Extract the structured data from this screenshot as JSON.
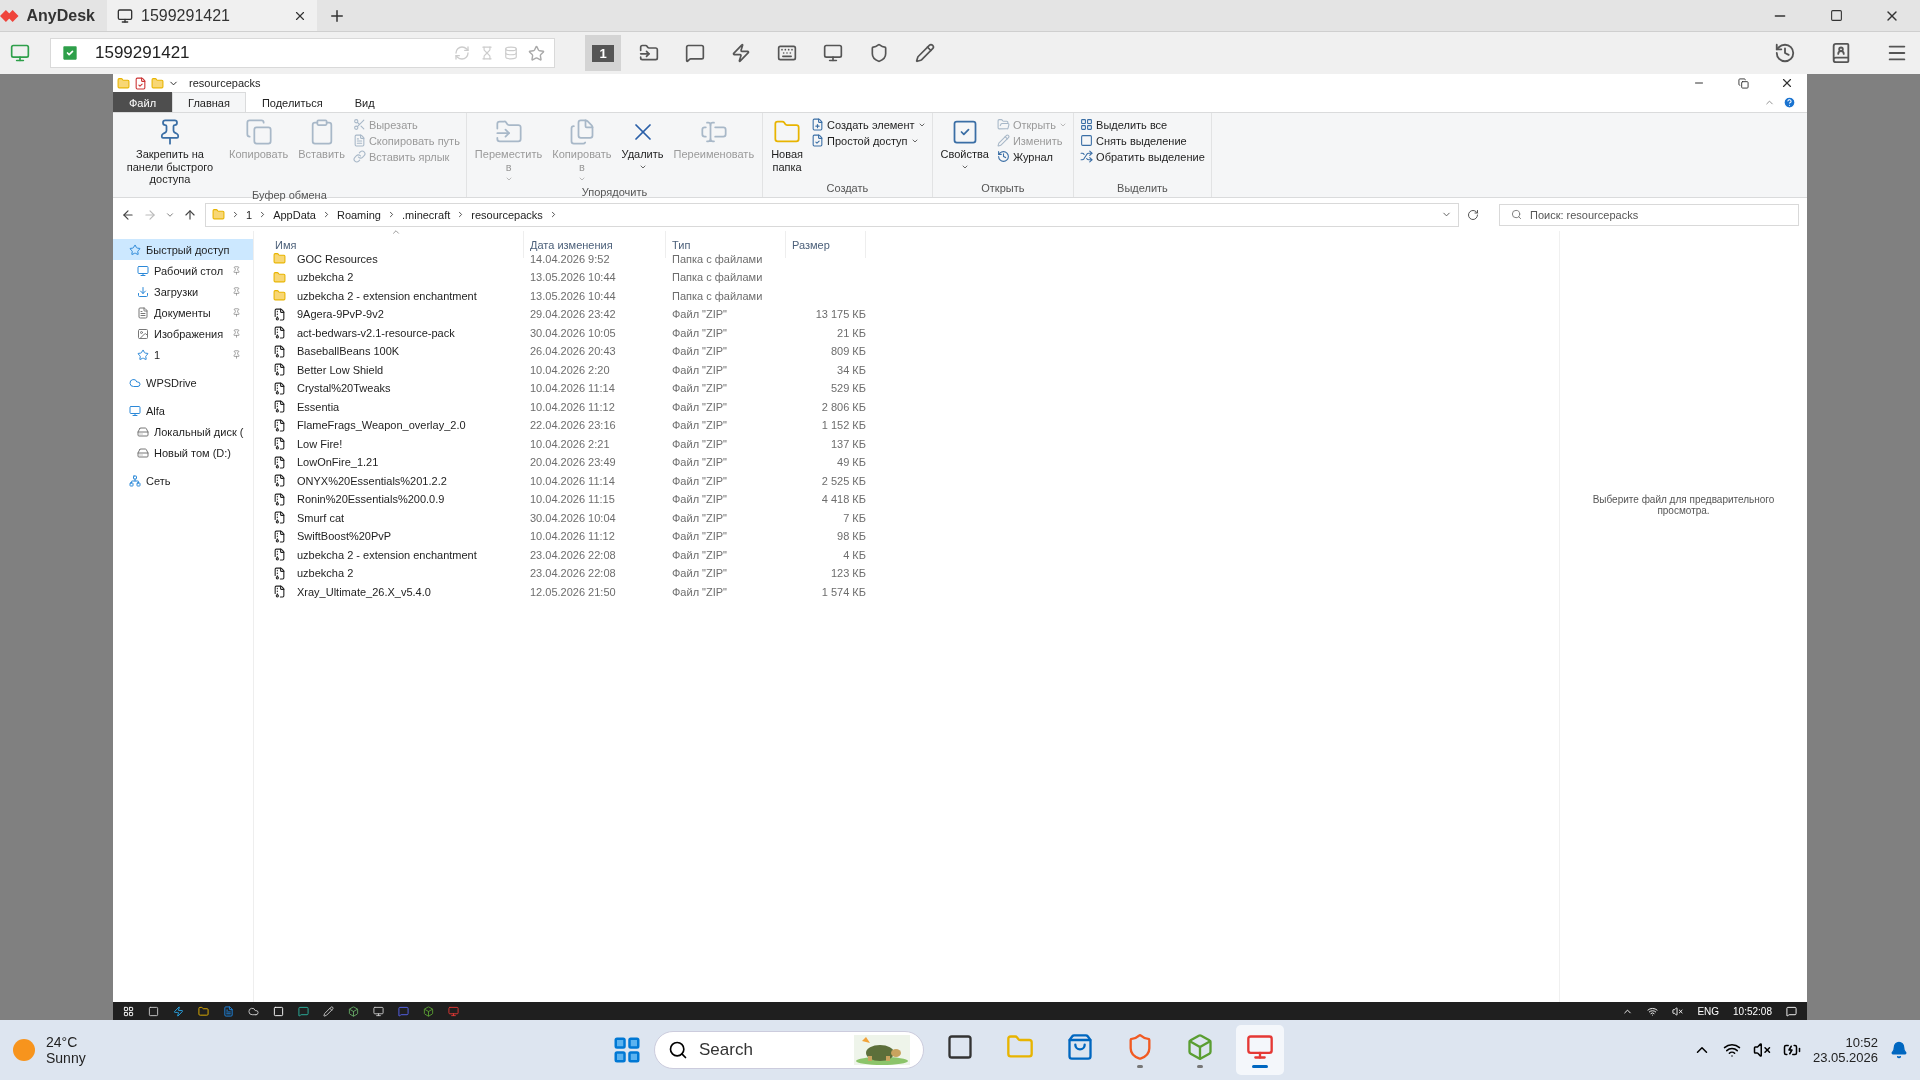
{
  "anydesk": {
    "brand": "AnyDesk",
    "tabs": [
      {
        "label": "1599291421",
        "selected": true
      }
    ],
    "address": {
      "value": "1599291421"
    },
    "monitor_button": {
      "label": "1",
      "selected": true
    }
  },
  "explorer": {
    "title": "resourcepacks",
    "tabs": [
      {
        "label": "Файл",
        "kind": "file",
        "selected": false
      },
      {
        "label": "Главная",
        "kind": "tab",
        "selected": true
      },
      {
        "label": "Поделиться",
        "kind": "tab",
        "selected": false
      },
      {
        "label": "Вид",
        "kind": "tab",
        "selected": false
      }
    ],
    "ribbon": [
      {
        "label": "Буфер обмена",
        "items": [
          {
            "label": "Закрепить на панели быстрого доступа",
            "kind": "large",
            "disabled": false,
            "menu": false
          },
          {
            "label": "Копировать",
            "kind": "large",
            "disabled": true,
            "menu": false
          },
          {
            "label": "Вставить",
            "kind": "large",
            "disabled": true,
            "menu": false
          },
          {
            "label": "Вырезать",
            "kind": "small",
            "disabled": true,
            "menu": false
          },
          {
            "label": "Скопировать путь",
            "kind": "small",
            "disabled": true,
            "menu": false
          },
          {
            "label": "Вставить ярлык",
            "kind": "small",
            "disabled": true,
            "menu": false
          }
        ]
      },
      {
        "label": "Упорядочить",
        "items": [
          {
            "label": "Переместить в",
            "kind": "large",
            "disabled": true,
            "menu": true
          },
          {
            "label": "Копировать в",
            "kind": "large",
            "disabled": true,
            "menu": true
          },
          {
            "label": "Удалить",
            "kind": "large",
            "disabled": false,
            "menu": true
          },
          {
            "label": "Переименовать",
            "kind": "large",
            "disabled": true,
            "menu": false
          }
        ]
      },
      {
        "label": "Создать",
        "items": [
          {
            "label": "Новая папка",
            "kind": "large",
            "disabled": false,
            "menu": false
          },
          {
            "label": "Создать элемент",
            "kind": "small",
            "disabled": false,
            "menu": true
          },
          {
            "label": "Простой доступ",
            "kind": "small",
            "disabled": false,
            "menu": true
          }
        ]
      },
      {
        "label": "Открыть",
        "items": [
          {
            "label": "Свойства",
            "kind": "large",
            "disabled": false,
            "menu": true
          },
          {
            "label": "Открыть",
            "kind": "small",
            "disabled": true,
            "menu": true
          },
          {
            "label": "Изменить",
            "kind": "small",
            "disabled": true,
            "menu": false
          },
          {
            "label": "Журнал",
            "kind": "small",
            "disabled": false,
            "menu": false
          }
        ]
      },
      {
        "label": "Выделить",
        "items": [
          {
            "label": "Выделить все",
            "kind": "small",
            "disabled": false,
            "menu": false
          },
          {
            "label": "Снять выделение",
            "kind": "small",
            "disabled": false,
            "menu": false
          },
          {
            "label": "Обратить выделение",
            "kind": "small",
            "disabled": false,
            "menu": false
          }
        ]
      }
    ],
    "breadcrumbs": [
      "1",
      "AppData",
      "Roaming",
      ".minecraft",
      "resourcepacks"
    ],
    "search": {
      "placeholder": "Поиск: resourcepacks"
    },
    "sidebar": [
      {
        "label": "Быстрый доступ",
        "selected": true,
        "children": [
          {
            "label": "Рабочий стол",
            "selected": false,
            "pinned": true
          },
          {
            "label": "Загрузки",
            "selected": false,
            "pinned": true
          },
          {
            "label": "Документы",
            "selected": false,
            "pinned": true
          },
          {
            "label": "Изображения",
            "selected": false,
            "pinned": true
          },
          {
            "label": "1",
            "selected": false,
            "pinned": true
          }
        ]
      },
      {
        "label": "WPSDrive",
        "selected": false
      },
      {
        "label": "Alfa",
        "selected": false,
        "children": [
          {
            "label": "Локальный диск (",
            "selected": false
          },
          {
            "label": "Новый том (D:)",
            "selected": false
          }
        ]
      },
      {
        "label": "Сеть",
        "selected": false
      }
    ],
    "columns": [
      {
        "label": "Имя",
        "sorted": true
      },
      {
        "label": "Дата изменения",
        "sorted": false
      },
      {
        "label": "Тип",
        "sorted": false
      },
      {
        "label": "Размер",
        "sorted": false
      }
    ],
    "rows": [
      {
        "kind": "folder",
        "name": "GOC Resources",
        "date": "14.04.2026 9:52",
        "type": "Папка с файлами",
        "size": ""
      },
      {
        "kind": "folder",
        "name": "uzbekcha 2",
        "date": "13.05.2026 10:44",
        "type": "Папка с файлами",
        "size": ""
      },
      {
        "kind": "folder",
        "name": "uzbekcha 2 - extension enchantment",
        "date": "13.05.2026 10:44",
        "type": "Папка с файлами",
        "size": ""
      },
      {
        "kind": "zip",
        "name": "9Agera-9PvP-9v2",
        "date": "29.04.2026 23:42",
        "type": "Файл \"ZIP\"",
        "size": "13 175 КБ"
      },
      {
        "kind": "zip",
        "name": "act-bedwars-v2.1-resource-pack",
        "date": "30.04.2026 10:05",
        "type": "Файл \"ZIP\"",
        "size": "21 КБ"
      },
      {
        "kind": "zip",
        "name": "BaseballBeans 100K",
        "date": "26.04.2026 20:43",
        "type": "Файл \"ZIP\"",
        "size": "809 КБ"
      },
      {
        "kind": "zip",
        "name": "Better Low Shield",
        "date": "10.04.2026 2:20",
        "type": "Файл \"ZIP\"",
        "size": "34 КБ"
      },
      {
        "kind": "zip",
        "name": "Crystal%20Tweaks",
        "date": "10.04.2026 11:14",
        "type": "Файл \"ZIP\"",
        "size": "529 КБ"
      },
      {
        "kind": "zip",
        "name": "Essentia",
        "date": "10.04.2026 11:12",
        "type": "Файл \"ZIP\"",
        "size": "2 806 КБ"
      },
      {
        "kind": "zip",
        "name": "FlameFrags_Weapon_overlay_2.0",
        "date": "22.04.2026 23:16",
        "type": "Файл \"ZIP\"",
        "size": "1 152 КБ"
      },
      {
        "kind": "zip",
        "name": "Low Fire!",
        "date": "10.04.2026 2:21",
        "type": "Файл \"ZIP\"",
        "size": "137 КБ"
      },
      {
        "kind": "zip",
        "name": "LowOnFire_1.21",
        "date": "20.04.2026 23:49",
        "type": "Файл \"ZIP\"",
        "size": "49 КБ"
      },
      {
        "kind": "zip",
        "name": "ONYX%20Essentials%201.2.2",
        "date": "10.04.2026 11:14",
        "type": "Файл \"ZIP\"",
        "size": "2 525 КБ"
      },
      {
        "kind": "zip",
        "name": "Ronin%20Essentials%200.0.9",
        "date": "10.04.2026 11:15",
        "type": "Файл \"ZIP\"",
        "size": "4 418 КБ"
      },
      {
        "kind": "zip",
        "name": "Smurf cat",
        "date": "30.04.2026 10:04",
        "type": "Файл \"ZIP\"",
        "size": "7 КБ"
      },
      {
        "kind": "zip",
        "name": "SwiftBoost%20PvP",
        "date": "10.04.2026 11:12",
        "type": "Файл \"ZIP\"",
        "size": "98 КБ"
      },
      {
        "kind": "zip",
        "name": "uzbekcha 2 - extension enchantment",
        "date": "23.04.2026 22:08",
        "type": "Файл \"ZIP\"",
        "size": "4 КБ"
      },
      {
        "kind": "zip",
        "name": "uzbekcha 2",
        "date": "23.04.2026 22:08",
        "type": "Файл \"ZIP\"",
        "size": "123 КБ"
      },
      {
        "kind": "zip",
        "name": "Xray_Ultimate_26.X_v5.4.0",
        "date": "12.05.2026 21:50",
        "type": "Файл \"ZIP\"",
        "size": "1 574 КБ"
      }
    ],
    "preview_text": "Выберите файл для предварительного просмотра."
  },
  "remote_taskbar": {
    "language": "ENG",
    "clock": "10:52:08"
  },
  "taskbar": {
    "weather": {
      "temperature": "24°C",
      "condition": "Sunny"
    },
    "search": {
      "placeholder": "Search"
    },
    "apps": [
      {
        "running": false,
        "selected": false
      },
      {
        "running": false,
        "selected": false
      },
      {
        "running": false,
        "selected": false
      },
      {
        "running": true,
        "selected": false
      },
      {
        "running": true,
        "selected": false
      },
      {
        "running": true,
        "selected": true
      }
    ],
    "time": "10:52",
    "date": "23.05.2026"
  }
}
